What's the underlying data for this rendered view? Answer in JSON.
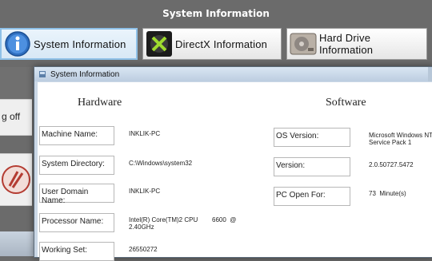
{
  "app": {
    "title": "System Information",
    "buttons": [
      {
        "label": "System Information",
        "icon": "info-icon"
      },
      {
        "label": "DirectX Information",
        "icon": "directx-icon"
      },
      {
        "label": "Hard Drive Information",
        "icon": "hard-drive-icon"
      }
    ],
    "left_partial_label": "g off"
  },
  "dialog": {
    "title": "System Information",
    "hardware": {
      "heading": "Hardware",
      "fields": [
        {
          "label": "Machine Name:",
          "value": "INKLIK-PC"
        },
        {
          "label": "System Directory:",
          "value": "C:\\Windows\\system32"
        },
        {
          "label": "User Domain Name:",
          "value": "INKLIK-PC"
        },
        {
          "label": "Processor Name:",
          "value": "Intel(R) Core(TM)2 CPU        6600  @\n2.40GHz"
        },
        {
          "label": "Working Set:",
          "value": "26550272"
        }
      ]
    },
    "software": {
      "heading": "Software",
      "fields": [
        {
          "label": "OS Version:",
          "value": "Microsoft Windows NT\nService Pack 1"
        },
        {
          "label": "Version:",
          "value": "2.0.50727.5472"
        },
        {
          "label": "PC Open For:",
          "value": "73  Minute(s)"
        }
      ]
    }
  }
}
